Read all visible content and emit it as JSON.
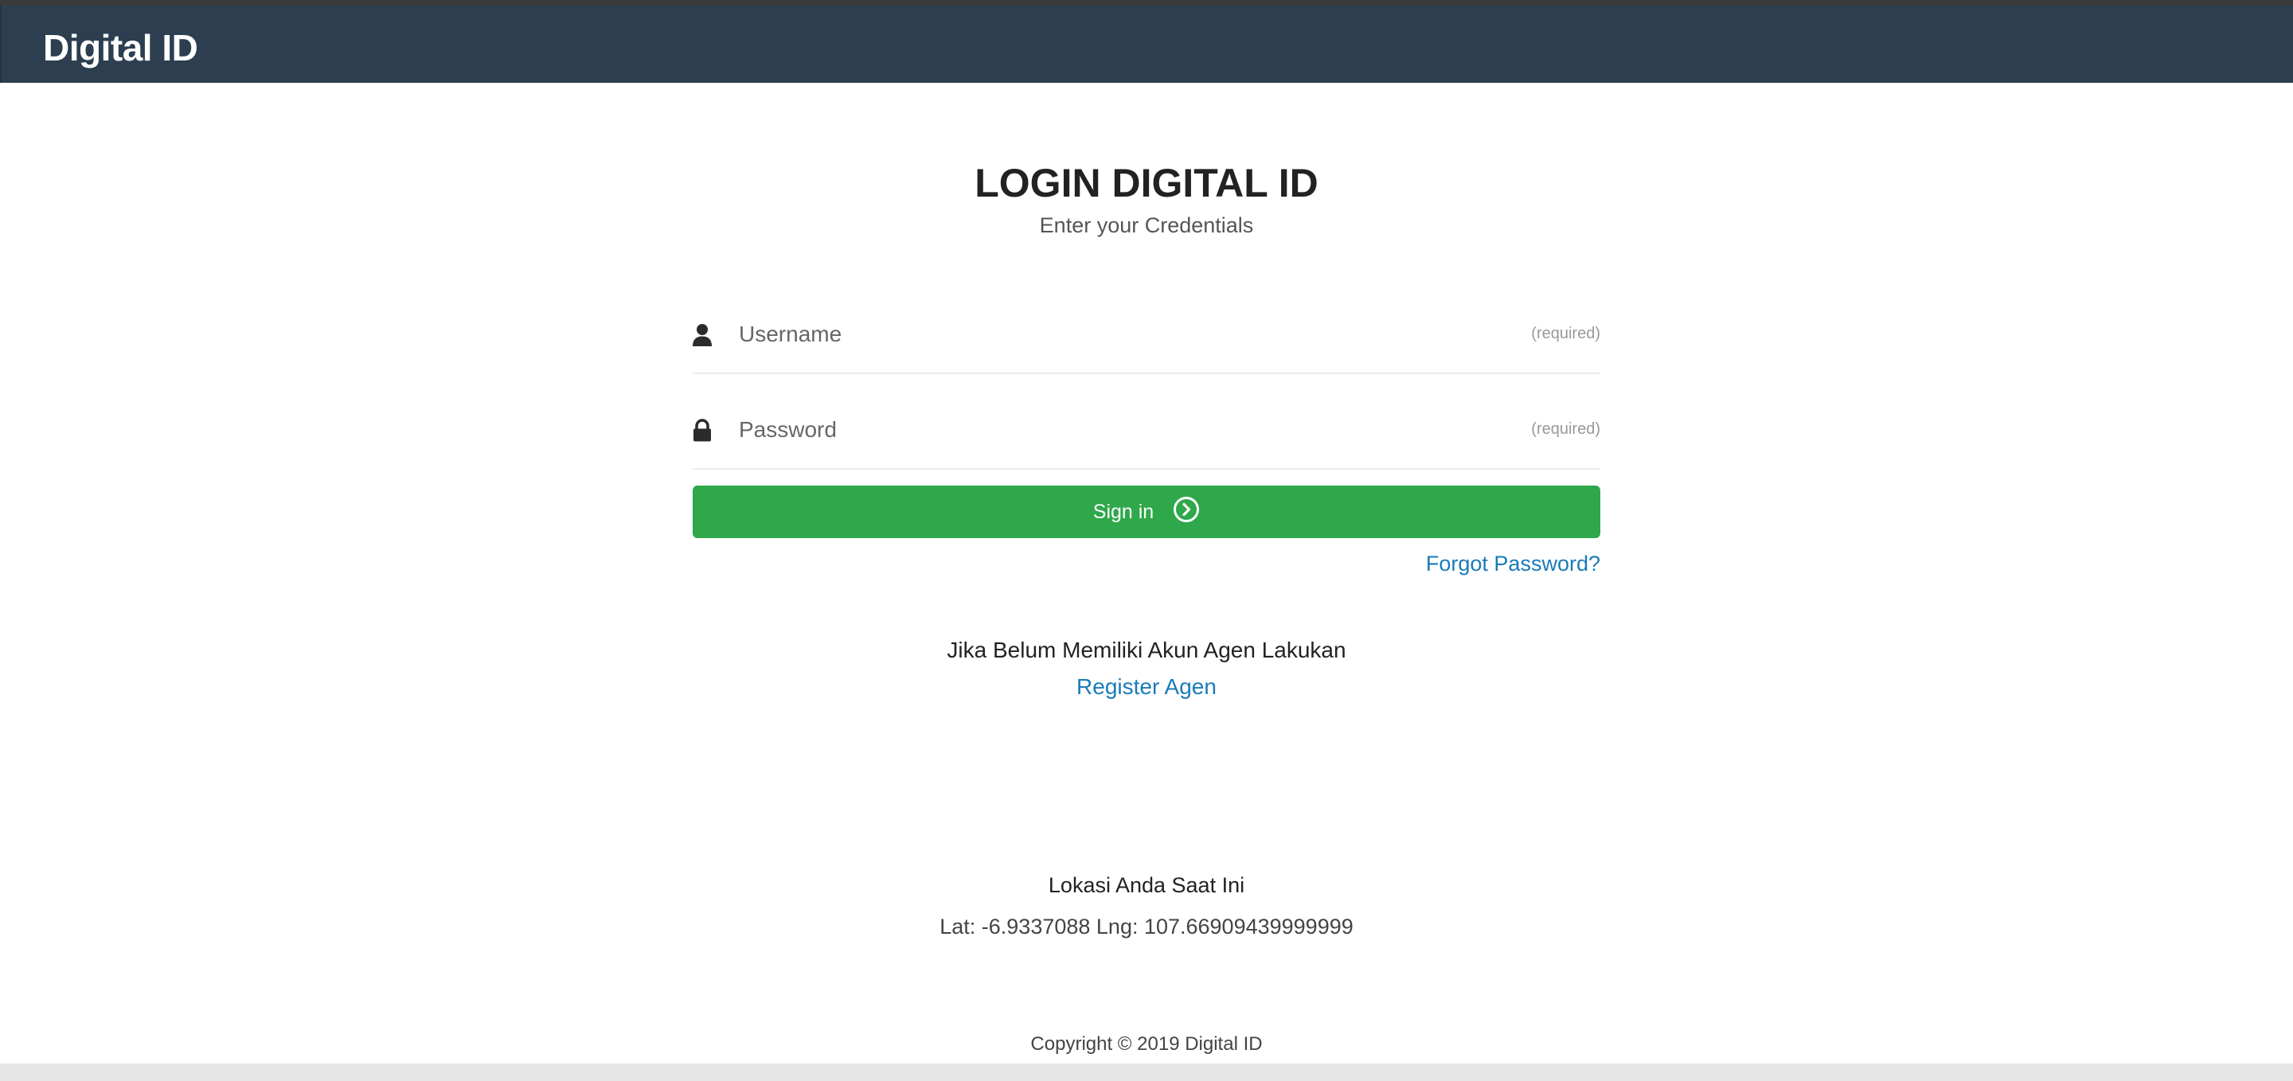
{
  "header": {
    "brand": "Digital ID"
  },
  "login": {
    "title": "LOGIN DIGITAL ID",
    "subtitle": "Enter your Credentials",
    "username": {
      "placeholder": "Username",
      "value": "",
      "hint": "(required)",
      "icon": "user-icon"
    },
    "password": {
      "placeholder": "Password",
      "value": "",
      "hint": "(required)",
      "icon": "lock-icon"
    },
    "signin_label": "Sign in",
    "signin_icon": "chevron-right-circle-icon",
    "forgot_label": "Forgot Password?"
  },
  "register": {
    "text": "Jika Belum Memiliki Akun Agen Lakukan",
    "link_label": "Register Agen"
  },
  "location": {
    "title": "Lokasi Anda Saat Ini",
    "coords": "Lat: -6.9337088 Lng: 107.66909439999999"
  },
  "footer": {
    "copyright": "Copyright © 2019 Digital ID"
  },
  "colors": {
    "navbar": "#2c3e50",
    "button": "#2ea84a",
    "link": "#1a7bb9"
  }
}
